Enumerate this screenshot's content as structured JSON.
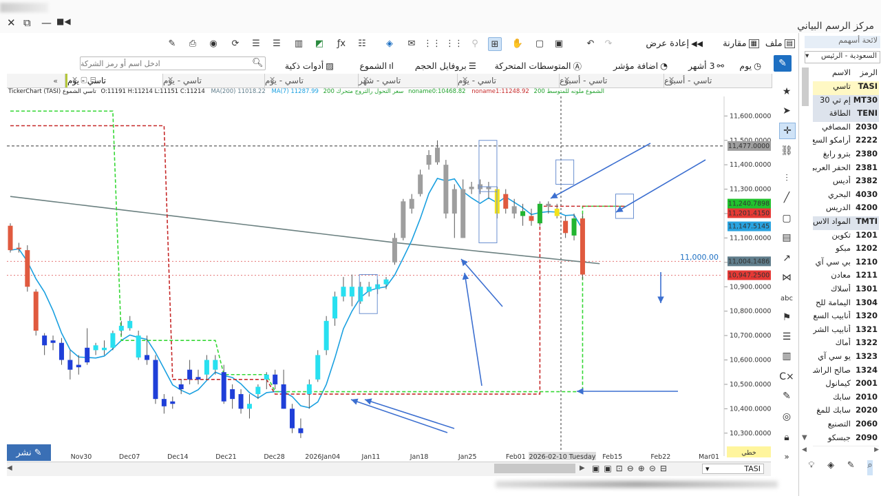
{
  "window": {
    "title": "مركز الرسم البياني",
    "controls": [
      "✕",
      "⧉",
      "—"
    ]
  },
  "toolbar1": {
    "file": "ملف",
    "compare": "مقارنة",
    "replay": "إعادة عرض"
  },
  "toolbar2": {
    "period": "يوم",
    "range": "3 أشهر",
    "add_indicator": "اضافة مؤشر",
    "moving_averages": "المتوسطات المتحركة",
    "volume_profile": "بروفايل الحجم",
    "candles": "الشموع",
    "smart_tools": "أدوات ذكية"
  },
  "search": {
    "placeholder": "ادخل اسم أو رمز الشركة"
  },
  "tabs": [
    {
      "label": "تاسي - يوم",
      "active": true
    },
    {
      "label": "تاسي - يوم",
      "active": false
    },
    {
      "label": "تاسي - يوم",
      "active": false
    },
    {
      "label": "تاسي - شهر",
      "active": false
    },
    {
      "label": "تاسي - يوم",
      "active": false
    },
    {
      "label": "تاسي - أسبوع",
      "active": false
    },
    {
      "label": "تاسي - أسبوع",
      "active": false
    },
    {
      "label": "تاسي - أسبوع",
      "active": false
    }
  ],
  "tabs_more": "»",
  "infobar": {
    "symbol": "TickerChart (TASI) تاسي الشموع",
    "ohlc": "O:11191   H:11214   L:11151   C:11214",
    "ma200_label": "MA(200)",
    "ma200_value": "11018.22",
    "ma7_label": "MA(7)",
    "ma7_value": "11287.99",
    "trail": "سعر التحول رالتروج متحرك 200",
    "noname1": "noname0:10468.82",
    "noname2": "noname1:11248.92",
    "tail": "الشموع ملونه للمتوسط 200"
  },
  "chart_data": {
    "type": "candlestick",
    "y_ticks": [
      "11,600.0000",
      "11,500.0000",
      "11,400.0000",
      "11,300.0000",
      "11,200.0000",
      "11,100.0000",
      "11,000.0000",
      "10,900.0000",
      "10,800.0000",
      "10,700.0000",
      "10,600.0000",
      "10,500.0000",
      "10,400.0000",
      "10,300.0000"
    ],
    "y_range": [
      10240,
      11680
    ],
    "x_ticks": [
      "Nov30",
      "Dec07",
      "Dec14",
      "Dec21",
      "Dec28",
      "2026Jan04",
      "Jan11",
      "Jan18",
      "Jan25",
      "Feb01",
      "Feb08",
      "Feb15",
      "Feb22",
      "Mar01"
    ],
    "crosshair_date": "2026-02-10 Tuesday",
    "price_labels": [
      {
        "value": "11,477.0000",
        "price": 11477,
        "color": "#9e9e9e"
      },
      {
        "value": "11,240.7898",
        "price": 11240.79,
        "color": "#22c22e"
      },
      {
        "value": "11,201.4150",
        "price": 11201.42,
        "color": "#e53935"
      },
      {
        "value": "11,147.5145",
        "price": 11147.51,
        "color": "#29a3e0"
      },
      {
        "value": "11,004.1486",
        "price": 11004.15,
        "color": "#607d8b"
      },
      {
        "value": "10,947.2500",
        "price": 10947.25,
        "color": "#e53935"
      }
    ],
    "level_label": "11,000.00",
    "axis_mode": "خطي",
    "candles": [
      [
        11150,
        11160,
        11040,
        11050,
        "#e05a3f"
      ],
      [
        11060,
        11080,
        11040,
        11060,
        "#e05a3f"
      ],
      [
        11050,
        11070,
        10880,
        10900,
        "#e05a3f"
      ],
      [
        10880,
        10890,
        10700,
        10720,
        "#e05a3f"
      ],
      [
        10700,
        10710,
        10620,
        10660,
        "#1f3fd8"
      ],
      [
        10680,
        10700,
        10640,
        10670,
        "#1f3fd8"
      ],
      [
        10670,
        10690,
        10580,
        10600,
        "#1f3fd8"
      ],
      [
        10600,
        10640,
        10520,
        10560,
        "#1f3fd8"
      ],
      [
        10580,
        10620,
        10540,
        10570,
        "#1f3fd8"
      ],
      [
        10590,
        10730,
        10580,
        10650,
        "#1f3fd8"
      ],
      [
        10640,
        10670,
        10620,
        10660,
        "#28e0f0"
      ],
      [
        10650,
        10680,
        10620,
        10640,
        "#28e0f0"
      ],
      [
        10650,
        10720,
        10640,
        10710,
        "#28e0f0"
      ],
      [
        10720,
        10760,
        10700,
        10740,
        "#28e0f0"
      ],
      [
        10730,
        10780,
        10720,
        10760,
        "#28e0f0"
      ],
      [
        10700,
        10720,
        10600,
        10610,
        "#28e0f0"
      ],
      [
        10620,
        10700,
        10580,
        10600,
        "#1f3fd8"
      ],
      [
        10600,
        10620,
        10420,
        10440,
        "#1f3fd8"
      ],
      [
        10440,
        10460,
        10380,
        10410,
        "#1f3fd8"
      ],
      [
        10420,
        10450,
        10400,
        10430,
        "#1f3fd8"
      ],
      [
        10480,
        10520,
        10460,
        10500,
        "#1f3fd8"
      ],
      [
        10560,
        10600,
        10500,
        10520,
        "#1f3fd8"
      ],
      [
        10520,
        10560,
        10500,
        10530,
        "#1f3fd8"
      ],
      [
        10540,
        10620,
        10520,
        10600,
        "#28e0f0"
      ],
      [
        10560,
        10620,
        10540,
        10600,
        "#28e0f0"
      ],
      [
        10550,
        10580,
        10420,
        10430,
        "#1f3fd8"
      ],
      [
        10440,
        10500,
        10400,
        10480,
        "#1f3fd8"
      ],
      [
        10460,
        10480,
        10380,
        10400,
        "#1f3fd8"
      ],
      [
        10400,
        10460,
        10360,
        10420,
        "#28e0f0"
      ],
      [
        10460,
        10500,
        10440,
        10490,
        "#28e0f0"
      ],
      [
        10520,
        10550,
        10480,
        10540,
        "#28e0f0"
      ],
      [
        10540,
        10560,
        10480,
        10500,
        "#1f3fd8"
      ],
      [
        10500,
        10560,
        10400,
        10400,
        "#1f3fd8"
      ],
      [
        10400,
        10420,
        10300,
        10320,
        "#1f3fd8"
      ],
      [
        10320,
        10360,
        10280,
        10300,
        "#1f3fd8"
      ],
      [
        10460,
        10520,
        10400,
        10500,
        "#28e0f0"
      ],
      [
        10520,
        10640,
        10510,
        10620,
        "#28e0f0"
      ],
      [
        10640,
        10780,
        10620,
        10760,
        "#28e0f0"
      ],
      [
        10770,
        10880,
        10740,
        10860,
        "#28e0f0"
      ],
      [
        10860,
        10940,
        10840,
        10900,
        "#28e0f0"
      ],
      [
        10900,
        10950,
        10820,
        10860,
        "#28e0f0"
      ],
      [
        10840,
        10920,
        10830,
        10900,
        "#28e0f0"
      ],
      [
        10880,
        10920,
        10860,
        10900,
        "#28e0f0"
      ],
      [
        10890,
        10930,
        10870,
        10910,
        "#28e0f0"
      ],
      [
        10910,
        10940,
        10890,
        10930,
        "#28e0f0"
      ],
      [
        11000,
        11120,
        10990,
        11100,
        "#9e9e9e"
      ],
      [
        11100,
        11260,
        11090,
        11250,
        "#9e9e9e"
      ],
      [
        11220,
        11280,
        11200,
        11260,
        "#9e9e9e"
      ],
      [
        11280,
        11380,
        11270,
        11360,
        "#9e9e9e"
      ],
      [
        11400,
        11460,
        11380,
        11440,
        "#9e9e9e"
      ],
      [
        11470,
        11500,
        11400,
        11410,
        "#9e9e9e"
      ],
      [
        11400,
        11420,
        11180,
        11200,
        "#9e9e9e"
      ],
      [
        11200,
        11320,
        11100,
        11300,
        "#9e9e9e"
      ],
      [
        11300,
        11340,
        11100,
        11100,
        "#9e9e9e"
      ],
      [
        11300,
        11330,
        11280,
        11310,
        "#9e9e9e"
      ],
      [
        11320,
        11340,
        11280,
        11300,
        "#9e9e9e"
      ],
      [
        11300,
        11330,
        11260,
        11310,
        "#9e9e9e"
      ],
      [
        11300,
        11310,
        11180,
        11200,
        "#f2e21b"
      ],
      [
        11280,
        11300,
        11200,
        11220,
        "#e05a3f"
      ],
      [
        11230,
        11260,
        11180,
        11200,
        "#9e9e9e"
      ],
      [
        11210,
        11240,
        11150,
        11190,
        "#22b531"
      ],
      [
        11190,
        11220,
        11150,
        11170,
        "#e05a3f"
      ],
      [
        11160,
        11250,
        11150,
        11240,
        "#22b531"
      ],
      [
        11230,
        11250,
        11200,
        11240,
        "#9e9e9e"
      ],
      [
        11220,
        11240,
        11180,
        11190,
        "#f2e21b"
      ],
      [
        11170,
        11190,
        11100,
        11120,
        "#e05a3f"
      ],
      [
        11110,
        11200,
        11090,
        11180,
        "#22b531"
      ],
      [
        11180,
        11200,
        10930,
        10950,
        "#e05a3f"
      ]
    ]
  },
  "sidebar": {
    "watchlist": "لائحة أسهمم",
    "market": "السعودية - الرئيس",
    "header": {
      "code": "الرمز",
      "name": "الاسم"
    },
    "rows": [
      {
        "code": "TASI",
        "name": "تاسي"
      },
      {
        "code": "MT30",
        "name": "إم تي 30"
      },
      {
        "code": "TENI",
        "name": "الطاقة"
      },
      {
        "code": "2030",
        "name": "المصافي"
      },
      {
        "code": "2222",
        "name": "أرامكو السع"
      },
      {
        "code": "2380",
        "name": "بترو رابغ"
      },
      {
        "code": "2381",
        "name": "الحفر العربي"
      },
      {
        "code": "2382",
        "name": "أديس"
      },
      {
        "code": "4030",
        "name": "البحري"
      },
      {
        "code": "4200",
        "name": "الدريس"
      },
      {
        "code": "TMTI",
        "name": "المواد الاس"
      },
      {
        "code": "1201",
        "name": "تكوين"
      },
      {
        "code": "1202",
        "name": "مبكو"
      },
      {
        "code": "1210",
        "name": "بي سي آي"
      },
      {
        "code": "1211",
        "name": "معادن"
      },
      {
        "code": "1301",
        "name": "أسلاك"
      },
      {
        "code": "1304",
        "name": "اليمامة للح"
      },
      {
        "code": "1320",
        "name": "أنابيب السع"
      },
      {
        "code": "1321",
        "name": "أنابيب الشر"
      },
      {
        "code": "1322",
        "name": "أماك"
      },
      {
        "code": "1323",
        "name": "يو سي آي"
      },
      {
        "code": "1324",
        "name": "صالح الراشد"
      },
      {
        "code": "2001",
        "name": "كيمانول"
      },
      {
        "code": "2010",
        "name": "سابك"
      },
      {
        "code": "2020",
        "name": "سابك للمغ"
      },
      {
        "code": "2060",
        "name": "التصنيع"
      },
      {
        "code": "2090",
        "name": "جبسكو"
      }
    ]
  },
  "bottom": {
    "publish": "نشر",
    "symbol": "TASI"
  },
  "icons": [
    "pencil-icon",
    "star-icon",
    "cursor-icon",
    "crosshair-icon",
    "link-icon",
    "line-icon",
    "rectangle-icon",
    "text-icon",
    "flag-icon",
    "lock-icon",
    "eye-off-icon",
    "magnet-icon",
    "search-icon",
    "zoom-in-icon",
    "zoom-out-icon"
  ]
}
